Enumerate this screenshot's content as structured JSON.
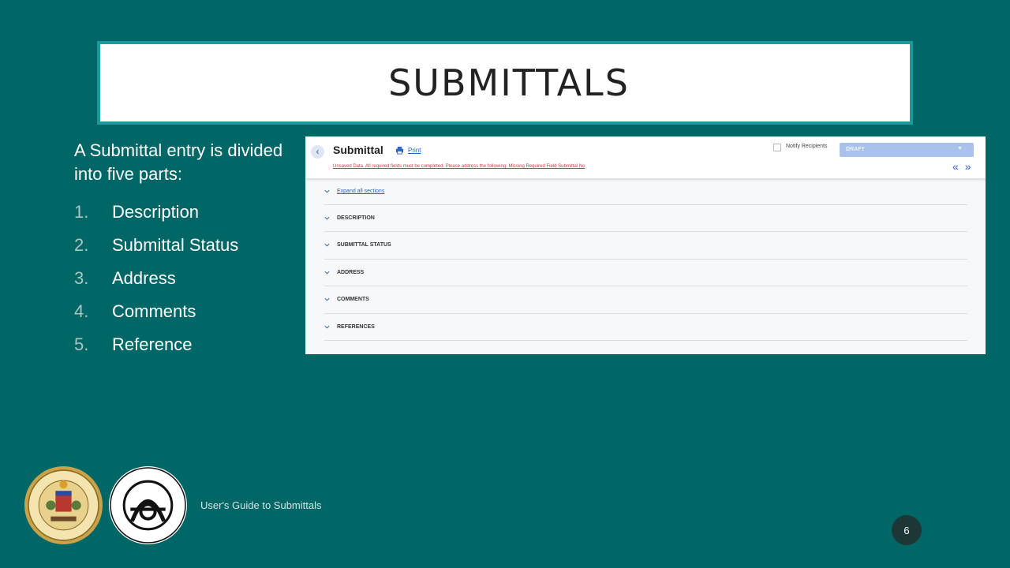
{
  "slide": {
    "title": "SUBMITTALS",
    "intro": "A Submittal entry is divided into five parts:",
    "steps": [
      {
        "num": "1.",
        "label": "Description"
      },
      {
        "num": "2.",
        "label": "Submittal Status"
      },
      {
        "num": "3.",
        "label": "Address"
      },
      {
        "num": "4.",
        "label": "Comments"
      },
      {
        "num": "5.",
        "label": "Reference"
      }
    ],
    "footer": "User's Guide to Submittals",
    "page_number": "6",
    "colors": {
      "background": "#006666",
      "title_border": "#1a9a9a",
      "page_badge": "#1d3636"
    }
  },
  "screenshot": {
    "back_icon": "chevron-left-icon",
    "title": "Submittal",
    "print_icon": "printer-icon",
    "print_label": "Print",
    "warning": "Unsaved Data. All required fields must be completed. Please address the following: Missing Required Field Submittal No",
    "notify_label": "Notify Recipients",
    "notify_checked": false,
    "status_value": "DRAFT",
    "nav_prev": "«",
    "nav_next": "»",
    "expand_label": "Expand all sections",
    "sections": [
      "DESCRIPTION",
      "SUBMITTAL STATUS",
      "ADDRESS",
      "COMMENTS",
      "REFERENCES"
    ],
    "colors": {
      "link": "#2a62c9",
      "warning": "#d2334a",
      "status_select": "#a9c1eb"
    }
  }
}
